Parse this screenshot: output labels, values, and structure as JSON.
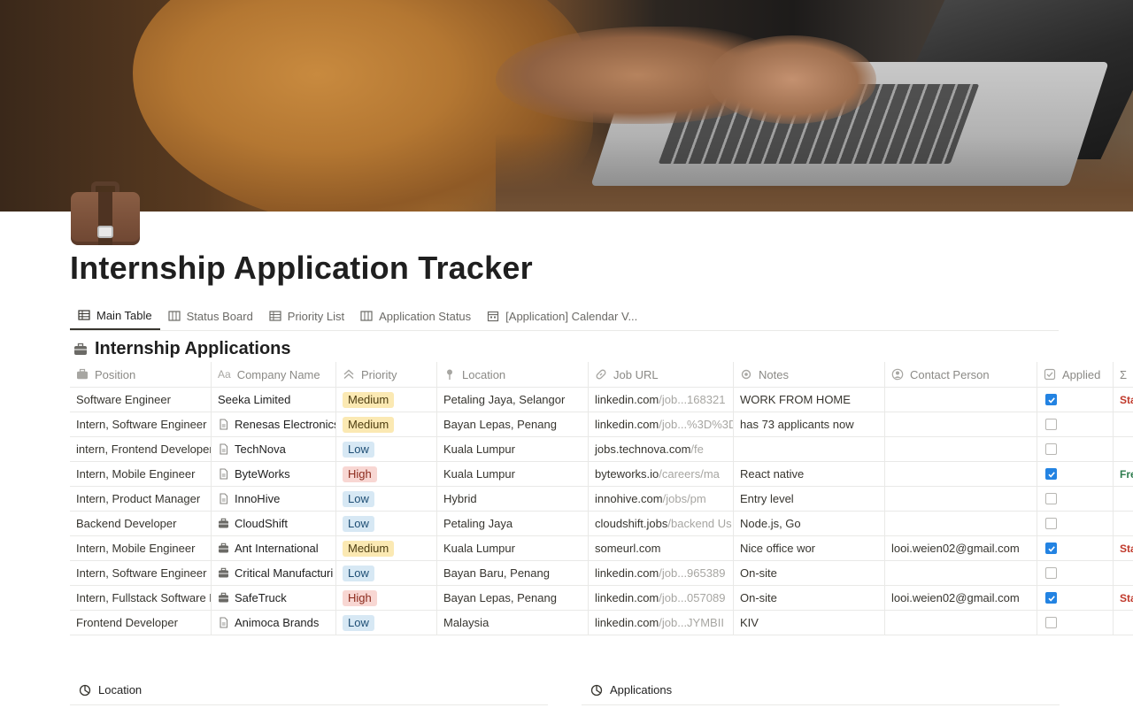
{
  "page": {
    "title": "Internship Application Tracker",
    "icon": "briefcase-icon"
  },
  "tabs": [
    {
      "label": "Main Table",
      "icon": "table-icon",
      "active": true
    },
    {
      "label": "Status Board",
      "icon": "board-icon",
      "active": false
    },
    {
      "label": "Priority List",
      "icon": "table-icon",
      "active": false
    },
    {
      "label": "Application Status",
      "icon": "board-icon",
      "active": false
    },
    {
      "label": "[Application] Calendar V...",
      "icon": "calendar-icon",
      "active": false
    }
  ],
  "database": {
    "title": "Internship Applications",
    "icon": "briefcase-icon"
  },
  "columns": {
    "position": "Position",
    "company": "Company Name",
    "priority": "Priority",
    "location": "Location",
    "job_url": "Job URL",
    "notes": "Notes",
    "contact": "Contact Person",
    "applied": "Applied",
    "formula_icon": "Σ"
  },
  "rows": [
    {
      "position": "Software Engineer",
      "company": "Seeka Limited",
      "company_icon": "",
      "priority": "Medium",
      "location": "Petaling Jaya, Selangor",
      "url_main": "linkedin.com",
      "url_dim": "/job...168321",
      "notes": "WORK FROM HOME",
      "contact": "",
      "applied": true,
      "status": "Sta"
    },
    {
      "position": "Intern, Software Engineer",
      "company": "Renesas Electronics",
      "company_icon": "page-icon",
      "priority": "Medium",
      "location": "Bayan Lepas, Penang",
      "url_main": "linkedin.com",
      "url_dim": "/job...%3D%3D",
      "notes": "has 73 applicants now",
      "contact": "",
      "applied": false,
      "status": ""
    },
    {
      "position": "intern, Frontend Developer",
      "company": "TechNova",
      "company_icon": "page-icon",
      "priority": "Low",
      "location": "Kuala Lumpur",
      "url_main": "jobs.technova.com",
      "url_dim": "/fe",
      "notes": "",
      "contact": "",
      "applied": false,
      "status": ""
    },
    {
      "position": "Intern, Mobile Engineer",
      "company": "ByteWorks",
      "company_icon": "page-icon",
      "priority": "High",
      "location": "Kuala Lumpur",
      "url_main": "byteworks.io",
      "url_dim": "/careers/ma",
      "notes": "React native",
      "contact": "",
      "applied": true,
      "status": "Fre"
    },
    {
      "position": "Intern, Product Manager",
      "company": "InnoHive",
      "company_icon": "page-icon",
      "priority": "Low",
      "location": "Hybrid",
      "url_main": "innohive.com",
      "url_dim": "/jobs/pm",
      "notes": "Entry level",
      "contact": "",
      "applied": false,
      "status": ""
    },
    {
      "position": "Backend Developer",
      "company": "CloudShift",
      "company_icon": "briefcase-icon",
      "priority": "Low",
      "location": "Petaling Jaya",
      "url_main": "cloudshift.jobs",
      "url_dim": "/backend Us",
      "notes": "Node.js, Go",
      "contact": "",
      "applied": false,
      "status": ""
    },
    {
      "position": "Intern, Mobile Engineer",
      "company": "Ant International",
      "company_icon": "briefcase-icon",
      "priority": "Medium",
      "location": "Kuala Lumpur",
      "url_main": "someurl.com",
      "url_dim": "",
      "notes": "Nice office wor",
      "contact": "looi.weien02@gmail.com",
      "applied": true,
      "status": "Sta"
    },
    {
      "position": "Intern, Software Engineer",
      "company": "Critical Manufacturi",
      "company_icon": "briefcase-icon",
      "priority": "Low",
      "location": "Bayan Baru, Penang",
      "url_main": "linkedin.com",
      "url_dim": "/job...965389",
      "notes": "On-site",
      "contact": "",
      "applied": false,
      "status": ""
    },
    {
      "position": "Intern, Fullstack Software D",
      "company": "SafeTruck",
      "company_icon": "briefcase-icon",
      "priority": "High",
      "location": "Bayan Lepas, Penang",
      "url_main": "linkedin.com",
      "url_dim": "/job...057089",
      "notes": "On-site",
      "contact": "looi.weien02@gmail.com",
      "applied": true,
      "status": "Sta"
    },
    {
      "position": "Frontend Developer",
      "company": "Animoca Brands",
      "company_icon": "page-icon",
      "priority": "Low",
      "location": "Malaysia",
      "url_main": "linkedin.com",
      "url_dim": "/job...JYMBII",
      "notes": "KIV",
      "contact": "",
      "applied": false,
      "status": ""
    }
  ],
  "charts": {
    "left_title": "Location",
    "right_title": "Applications"
  },
  "colors": {
    "checkbox_checked": "#2383e2",
    "tag_medium": "#fbe9b3",
    "tag_low": "#d7e8f4",
    "tag_high": "#f8d7d3",
    "status_red": "#c0392b",
    "status_green": "#2f7d4f"
  }
}
